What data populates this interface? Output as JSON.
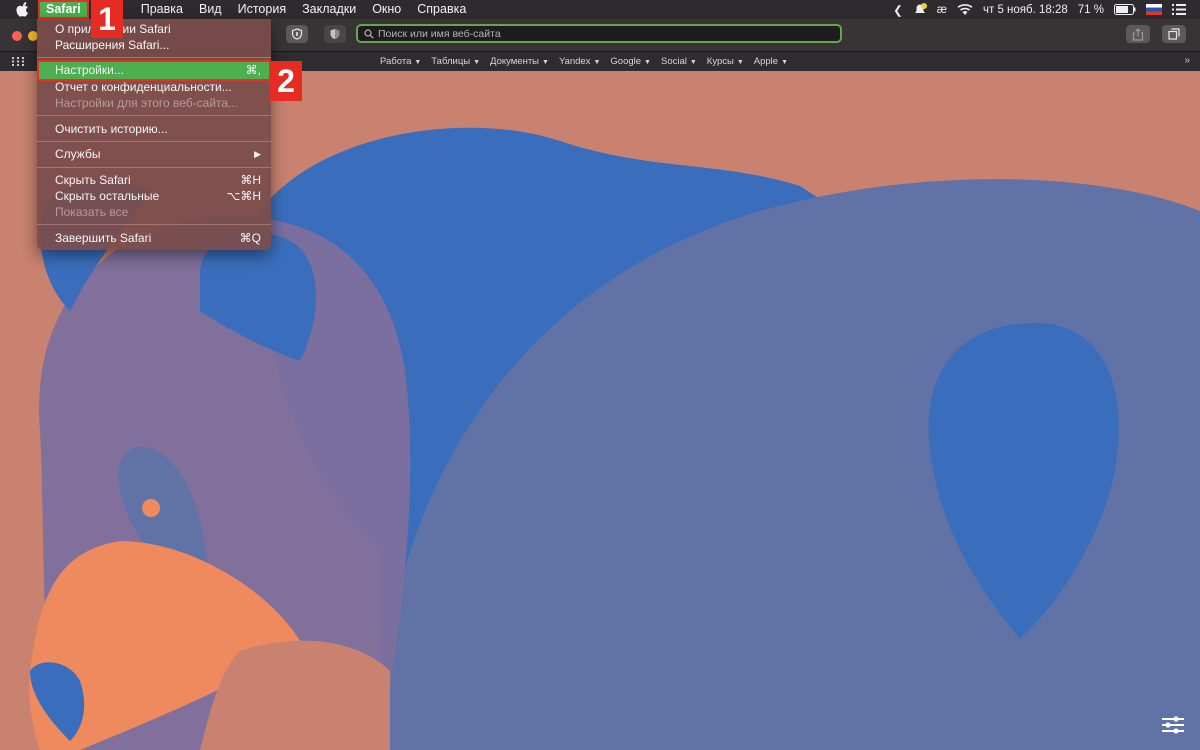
{
  "menubar": {
    "app": "Safari",
    "items": [
      "Правка",
      "Вид",
      "История",
      "Закладки",
      "Окно",
      "Справка"
    ],
    "status": {
      "date_time": "чт 5 нояб.  18:28",
      "battery": "71 %",
      "keyboard": "æ"
    }
  },
  "toolbar": {
    "address_placeholder": "Поиск или имя веб-сайта"
  },
  "favorites": {
    "items": [
      "Работа",
      "Таблицы",
      "Документы",
      "Yandex",
      "Google",
      "Social",
      "Курсы",
      "Apple"
    ]
  },
  "safari_menu": {
    "items": [
      {
        "label": "О приложении Safari",
        "shortcut": "",
        "disabled": false
      },
      {
        "label": "Расширения Safari...",
        "shortcut": "",
        "disabled": false
      },
      {
        "label": "Настройки...",
        "shortcut": "⌘,",
        "disabled": false
      },
      {
        "label": "Отчет о конфиденциальности...",
        "shortcut": "",
        "disabled": false
      },
      {
        "label": "Настройки для этого веб-сайта...",
        "shortcut": "",
        "disabled": true
      },
      {
        "label": "Очистить историю...",
        "shortcut": "",
        "disabled": false
      },
      {
        "label": "Службы",
        "shortcut": "▶",
        "disabled": false
      },
      {
        "label": "Скрыть Safari",
        "shortcut": "⌘H",
        "disabled": false
      },
      {
        "label": "Скрыть остальные",
        "shortcut": "⌥⌘H",
        "disabled": false
      },
      {
        "label": "Показать все",
        "shortcut": "",
        "disabled": true
      },
      {
        "label": "Завершить Safari",
        "shortcut": "⌘Q",
        "disabled": false
      }
    ]
  },
  "annotations": {
    "step1": "1",
    "step2": "2"
  },
  "colors": {
    "highlight": "#4caf50",
    "annotation": "#e52b22",
    "background": "#c98270",
    "bear_blue": "#3a6ebd",
    "bear_purple": "#6173a6",
    "bear_orange": "#ef8a5e"
  },
  "icons": [
    "apple-icon",
    "notification-icon",
    "wifi-icon",
    "flag-icon",
    "menu-list-icon",
    "shield-icon",
    "privacy-icon",
    "share-icon",
    "tabs-icon",
    "grid-icon",
    "settings-sliders-icon"
  ]
}
